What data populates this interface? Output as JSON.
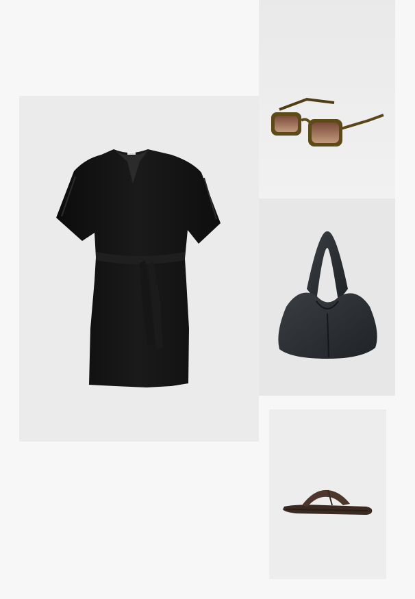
{
  "collage": {
    "items": [
      {
        "name": "dress"
      },
      {
        "name": "sunglasses"
      },
      {
        "name": "bag"
      },
      {
        "name": "sandal"
      }
    ]
  },
  "colors": {
    "page_background": "#f7f7f7",
    "tile_background": "#ececec",
    "dress": "#111111",
    "sunglasses_frame": "#5e4a18",
    "sunglasses_lens": "#9a6a4c",
    "bag": "#2a2d31",
    "sandal": "#4a3428"
  }
}
